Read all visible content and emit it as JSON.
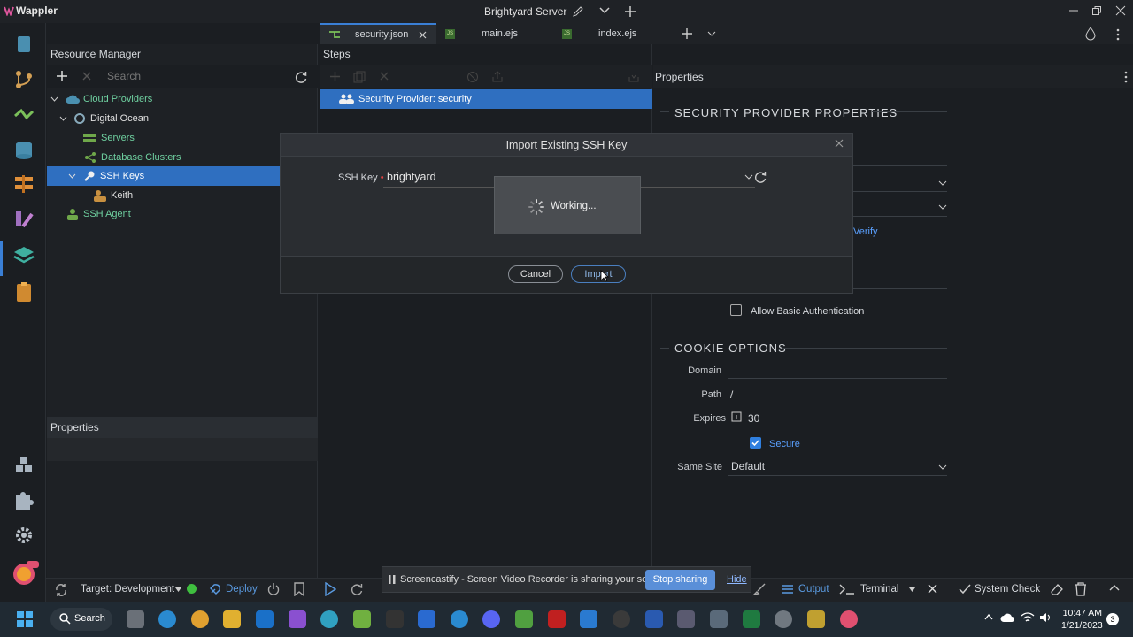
{
  "app": {
    "name": "Wappler",
    "window_title": "Brightyard Server"
  },
  "tabs": [
    {
      "label": "security.json",
      "active": true
    },
    {
      "label": "main.ejs",
      "active": false
    },
    {
      "label": "index.ejs",
      "active": false
    }
  ],
  "resource_manager": {
    "title": "Resource Manager",
    "search_placeholder": "Search",
    "tree": [
      {
        "label": "Cloud Providers"
      },
      {
        "label": "Digital Ocean"
      },
      {
        "label": "Servers"
      },
      {
        "label": "Database Clusters"
      },
      {
        "label": "SSH Keys"
      },
      {
        "label": "Keith"
      },
      {
        "label": "SSH Agent"
      }
    ],
    "properties_title": "Properties"
  },
  "steps": {
    "title": "Steps",
    "selected_item": "Security Provider: security"
  },
  "properties": {
    "title": "Properties",
    "section1": "SECURITY PROVIDER PROPERTIES",
    "verify_link": "Verify",
    "allow_basic_auth": "Allow Basic Authentication",
    "section2": "COOKIE OPTIONS",
    "domain_label": "Domain",
    "path_label": "Path",
    "path_value": "/",
    "expires_label": "Expires",
    "expires_value": "30",
    "secure_label": "Secure",
    "same_site_label": "Same Site",
    "same_site_value": "Default"
  },
  "modal": {
    "title": "Import Existing SSH Key",
    "ssh_key_label": "SSH Key",
    "ssh_key_value": "brightyard",
    "working_text": "Working...",
    "cancel_label": "Cancel",
    "import_label": "Import"
  },
  "statusbar": {
    "target_label": "Target: Development",
    "deploy_label": "Deploy",
    "output_label": "Output",
    "terminal_label": "Terminal",
    "system_check_label": "System Check"
  },
  "share_banner": {
    "text": "Screencastify - Screen Video Recorder is sharing your screen.",
    "stop_label": "Stop sharing",
    "hide_label": "Hide"
  },
  "taskbar": {
    "search_label": "Search",
    "time": "10:47 AM",
    "date": "1/21/2023",
    "notification_count": "3"
  },
  "colors": {
    "accent": "#2f6fc0",
    "green_status": "#3fbf3f",
    "folder_green": "#6fa84a",
    "link_blue": "#5aa0ff"
  }
}
